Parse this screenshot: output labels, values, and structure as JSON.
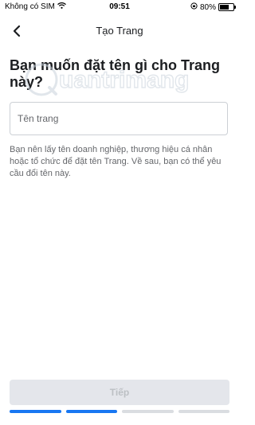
{
  "status_bar": {
    "carrier": "Không có SIM",
    "time": "09:51",
    "battery_percent": "80%",
    "battery_level": 0.8
  },
  "nav": {
    "title": "Tạo Trang"
  },
  "page": {
    "heading": "Bạn muốn đặt tên gì cho Trang này?",
    "input_placeholder": "Tên trang",
    "input_value": "",
    "helper_text": "Bạn nên lấy tên doanh nghiệp, thương hiệu cá nhân hoặc tổ chức để đặt tên Trang. Về sau, bạn có thể yêu cầu đổi tên này."
  },
  "watermark": {
    "text": "uantrimang"
  },
  "footer": {
    "next_label": "Tiếp",
    "progress": {
      "completed_steps": 2,
      "total_steps": 4,
      "active_color": "#1877f2",
      "inactive_color": "#dadde1"
    }
  }
}
